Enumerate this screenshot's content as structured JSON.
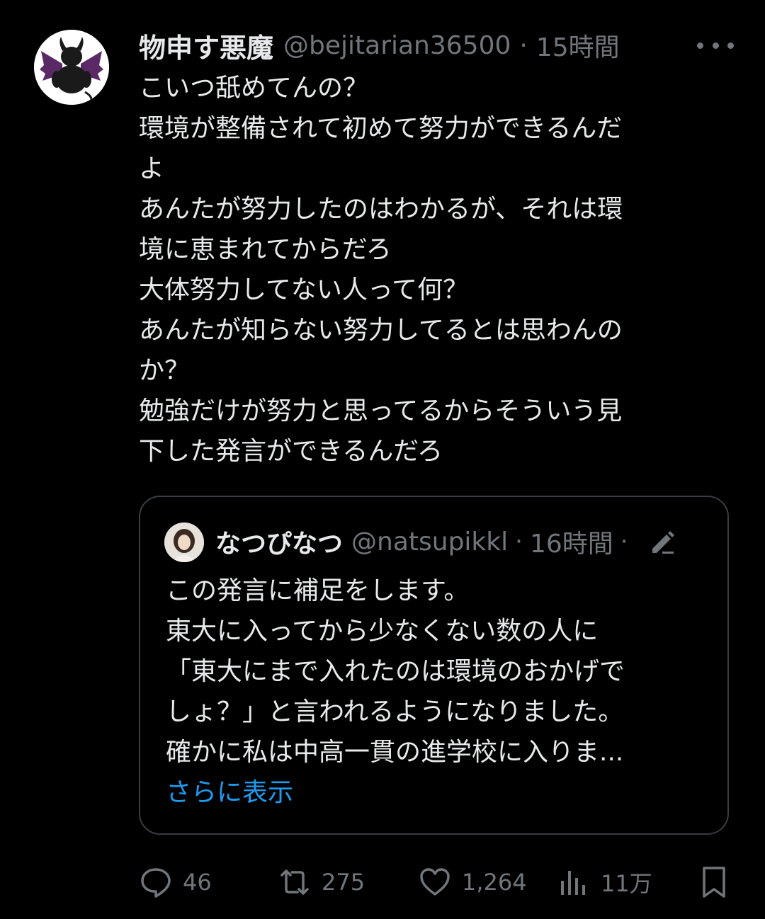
{
  "post": {
    "author": {
      "display_name": "物申す悪魔",
      "handle": "@bejitarian36500",
      "time": "15時間",
      "separator": "·"
    },
    "text_lines": [
      "こいつ舐めてんの？",
      "環境が整備されて初めて努力ができるんだ",
      "よ",
      "あんたが努力したのはわかるが、それは環",
      "境に恵まれてからだろ",
      "大体努力してない人って何？",
      "あんたが知らない努力してるとは思わんの",
      "か？",
      "勉強だけが努力と思ってるからそういう見",
      "下した発言ができるんだろ"
    ],
    "quote": {
      "display_name": "なつぴなつ",
      "handle": "@natsupikkl",
      "time": "16時間",
      "separator": "·",
      "text_lines": [
        "この発言に補足をします。",
        "東大に入ってから少なくない数の人に",
        "「東大にまで入れたのは環境のおかげで",
        "しょ？」と言われるようになりました。",
        "確かに私は中高一貫の進学校に入りま..."
      ],
      "show_more": "さらに表示"
    },
    "actions": {
      "replies": "46",
      "reposts": "275",
      "likes": "1,264",
      "views": "11万"
    }
  },
  "icons": {
    "avatar": "devil-avatar",
    "quote_avatar": "user-photo-avatar",
    "more": "more-icon",
    "edit": "edit-icon",
    "reply": "reply-icon",
    "repost": "repost-icon",
    "like": "like-icon",
    "views": "views-icon",
    "bookmark": "bookmark-icon"
  },
  "colors": {
    "background": "#000000",
    "text": "#e7e9ea",
    "secondary": "#71767b",
    "link": "#1d9bf0",
    "border": "#3a3d41"
  }
}
